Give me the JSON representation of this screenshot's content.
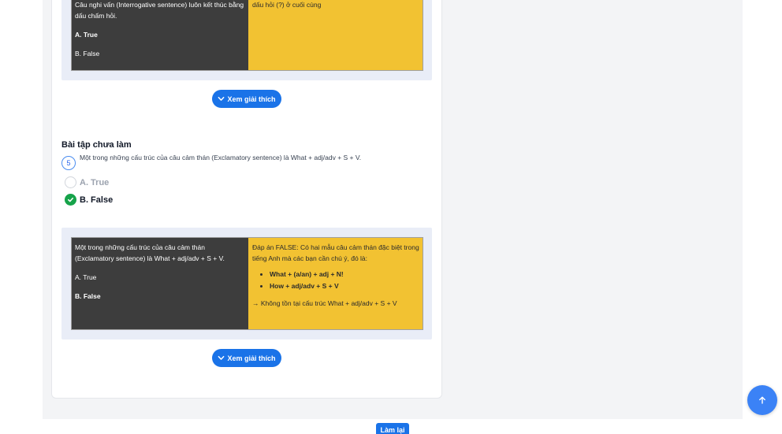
{
  "question_4": {
    "left_text": "Câu nghi vấn (Interrogative sentence) luôn kết thúc bằng dấu chấm hỏi.",
    "option_a": "A. True",
    "option_b": "B. False",
    "right_text": "dấu hỏi (?) ở cuối cùng"
  },
  "explain_button_label": "Xem giải thích",
  "section": {
    "title": "Bài tập chưa làm"
  },
  "question_5": {
    "number": "5",
    "text": "Một trong những cấu trúc của câu cảm thán (Exclamatory sentence) là What + adj/adv + S + V.",
    "answers": [
      {
        "label": "A. True",
        "selected": false
      },
      {
        "label": "B. False",
        "selected": true
      }
    ],
    "left_text": "Một trong những cấu trúc của câu cảm thán (Exclamatory sentence) là What + adj/adv + S + V.",
    "option_a": "A. True",
    "option_b": "B. False",
    "right_intro": "Đáp án FALSE: Có hai mẫu câu cảm thán đặc biệt trong tiếng Anh mà các bạn cần chú ý, đó là:",
    "bullets": [
      "What + (a/an) + adj + N!",
      "How + adj/adv + S + V"
    ],
    "conclusion": "→ Không tồn tại cấu trúc What + adj/adv + S + V"
  },
  "footer": {
    "retry_label": "Làm lại"
  },
  "icons": {
    "explain": "chevron-down-icon",
    "selected": "check-circle-icon",
    "scroll_top": "arrow-up-icon"
  },
  "colors": {
    "primary": "#1a73e8",
    "panel_dark": "#3d3d3d",
    "panel_yellow": "#f2c232",
    "success": "#16a34a"
  }
}
